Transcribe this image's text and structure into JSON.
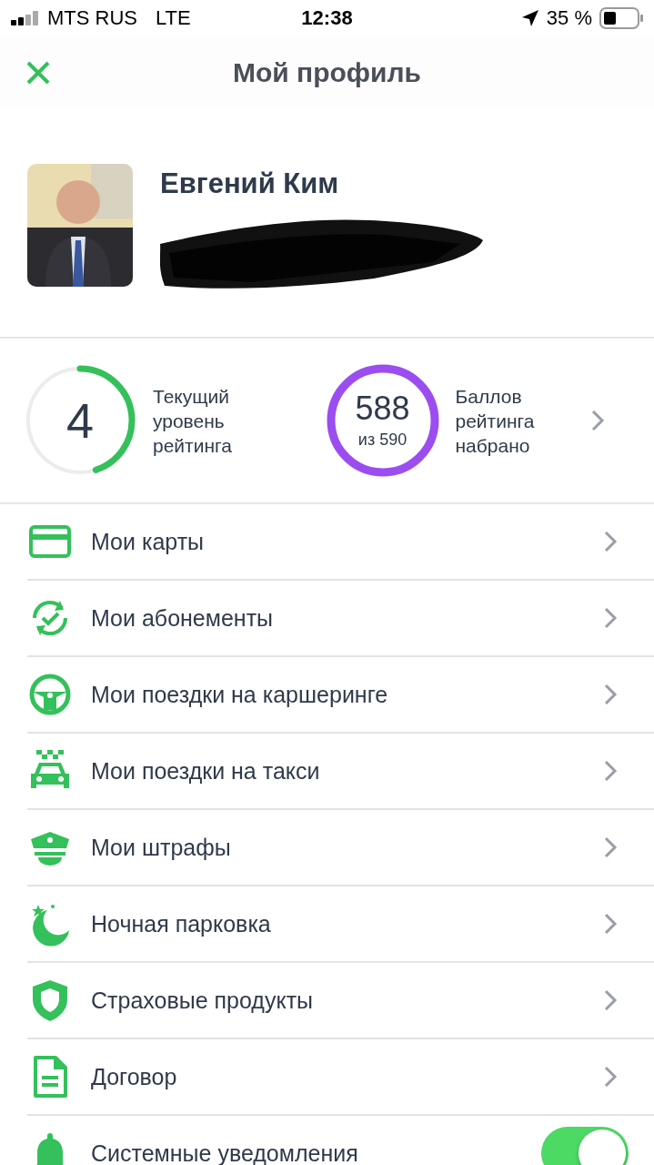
{
  "status_bar": {
    "carrier": "MTS RUS",
    "network": "LTE",
    "time": "12:38",
    "battery": "35 %"
  },
  "header": {
    "title": "Мой профиль"
  },
  "profile": {
    "name": "Евгений Ким"
  },
  "ratings": [
    {
      "kind": "level",
      "value": "4",
      "label": "Текущий уровень рейтинга",
      "level": 0.45
    },
    {
      "kind": "points",
      "value": "588",
      "sub": "из 590",
      "label": "Баллов рейтинга набрано",
      "level": 1
    }
  ],
  "menu": [
    {
      "label": "Мои карты",
      "kind": "link"
    },
    {
      "label": "Мои абонементы",
      "kind": "link"
    },
    {
      "label": "Мои поездки на каршеринге",
      "kind": "link"
    },
    {
      "label": "Мои поездки на такси",
      "kind": "link"
    },
    {
      "label": "Мои штрафы",
      "kind": "link"
    },
    {
      "label": "Ночная парковка",
      "kind": "link"
    },
    {
      "label": "Страховые продукты",
      "kind": "link"
    },
    {
      "label": "Договор",
      "kind": "link"
    },
    {
      "label": "Системные уведомления",
      "kind": "toggle",
      "on": true
    }
  ]
}
